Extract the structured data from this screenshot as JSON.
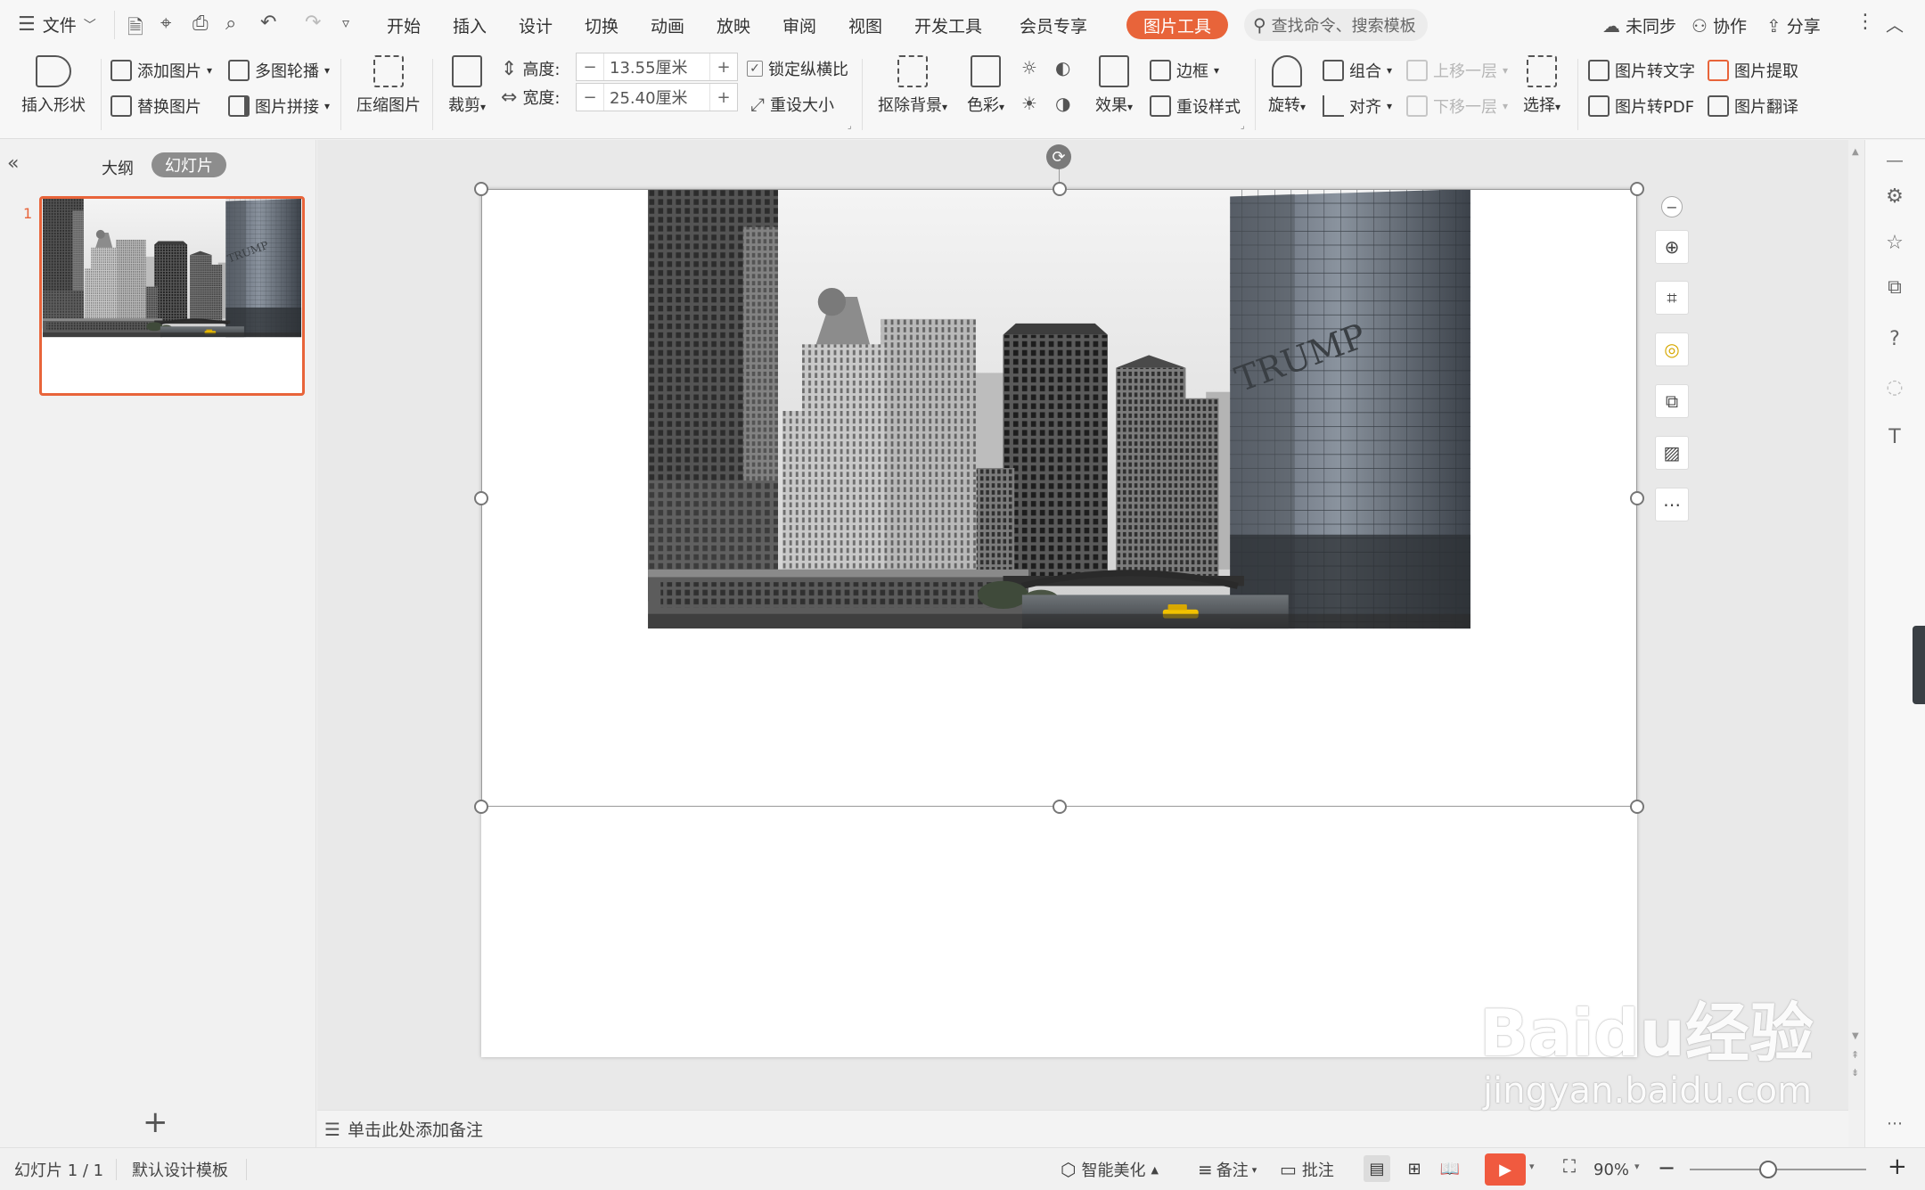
{
  "menubar": {
    "file_label": "文件",
    "tabs": [
      "开始",
      "插入",
      "设计",
      "切换",
      "动画",
      "放映",
      "审阅",
      "视图",
      "开发工具",
      "会员专享"
    ],
    "active_tab": "图片工具",
    "search_placeholder": "查找命令、搜索模板",
    "sync_label": "未同步",
    "collab_label": "协作",
    "share_label": "分享"
  },
  "ribbon": {
    "insert_shape": "插入形状",
    "add_image": "添加图片",
    "replace_image": "替换图片",
    "carousel": "多图轮播",
    "collage": "图片拼接",
    "compress": "压缩图片",
    "crop": "裁剪",
    "height_label": "高度:",
    "height_value": "13.55厘米",
    "width_label": "宽度:",
    "width_value": "25.40厘米",
    "lock_ratio": "锁定纵横比",
    "reset_size": "重设大小",
    "remove_bg": "抠除背景",
    "color": "色彩",
    "effects": "效果",
    "border": "边框",
    "reset_style": "重设样式",
    "rotate": "旋转",
    "group": "组合",
    "align": "对齐",
    "bring_forward": "上移一层",
    "send_backward": "下移一层",
    "select": "选择",
    "img_to_text": "图片转文字",
    "img_extract": "图片提取",
    "img_to_pdf": "图片转PDF",
    "img_translate": "图片翻译"
  },
  "left_pane": {
    "tab_outline": "大纲",
    "tab_slides": "幻灯片",
    "slide_number": "1"
  },
  "canvas": {
    "building_sign": "TRUMP"
  },
  "notes": {
    "placeholder": "单击此处添加备注"
  },
  "status": {
    "slide_info": "幻灯片 1 / 1",
    "template": "默认设计模板",
    "smart_beautify": "智能美化",
    "notes": "备注",
    "comments": "批注",
    "zoom": "90%"
  },
  "watermark": {
    "brand": "Baidu经验",
    "url": "jingyan.baidu.com"
  },
  "colors": {
    "accent": "#e8643a",
    "slide_border_selected": "#e8643a",
    "play_button": "#f05a3f",
    "taxi": "#f2c200"
  }
}
